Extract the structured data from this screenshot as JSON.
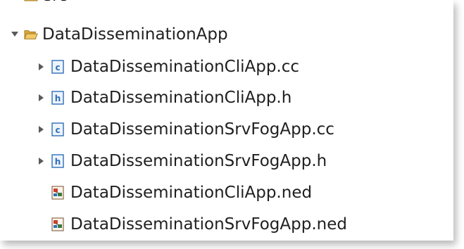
{
  "tree": {
    "top_item": {
      "label": "src",
      "icon": "folder-icon"
    },
    "folder": {
      "label": "DataDisseminationApp",
      "expanded": true,
      "icon": "open-folder-icon"
    },
    "files": [
      {
        "label": "DataDisseminationCliApp.cc",
        "icon": "c-source-file-icon",
        "expandable": true
      },
      {
        "label": "DataDisseminationCliApp.h",
        "icon": "header-file-icon",
        "expandable": true
      },
      {
        "label": "DataDisseminationSrvFogApp.cc",
        "icon": "c-source-file-icon",
        "expandable": true
      },
      {
        "label": "DataDisseminationSrvFogApp.h",
        "icon": "header-file-icon",
        "expandable": true
      },
      {
        "label": "DataDisseminationCliApp.ned",
        "icon": "ned-file-icon",
        "expandable": false
      },
      {
        "label": "DataDisseminationSrvFogApp.ned",
        "icon": "ned-file-icon",
        "expandable": false
      }
    ]
  },
  "colors": {
    "text": "#1f1f1f",
    "twisty": "#5a5a5a",
    "folder": "#e9b74a",
    "c_icon": "#2f6fb8",
    "h_icon": "#2f6fb8",
    "ned_icon": "#c8402e"
  }
}
